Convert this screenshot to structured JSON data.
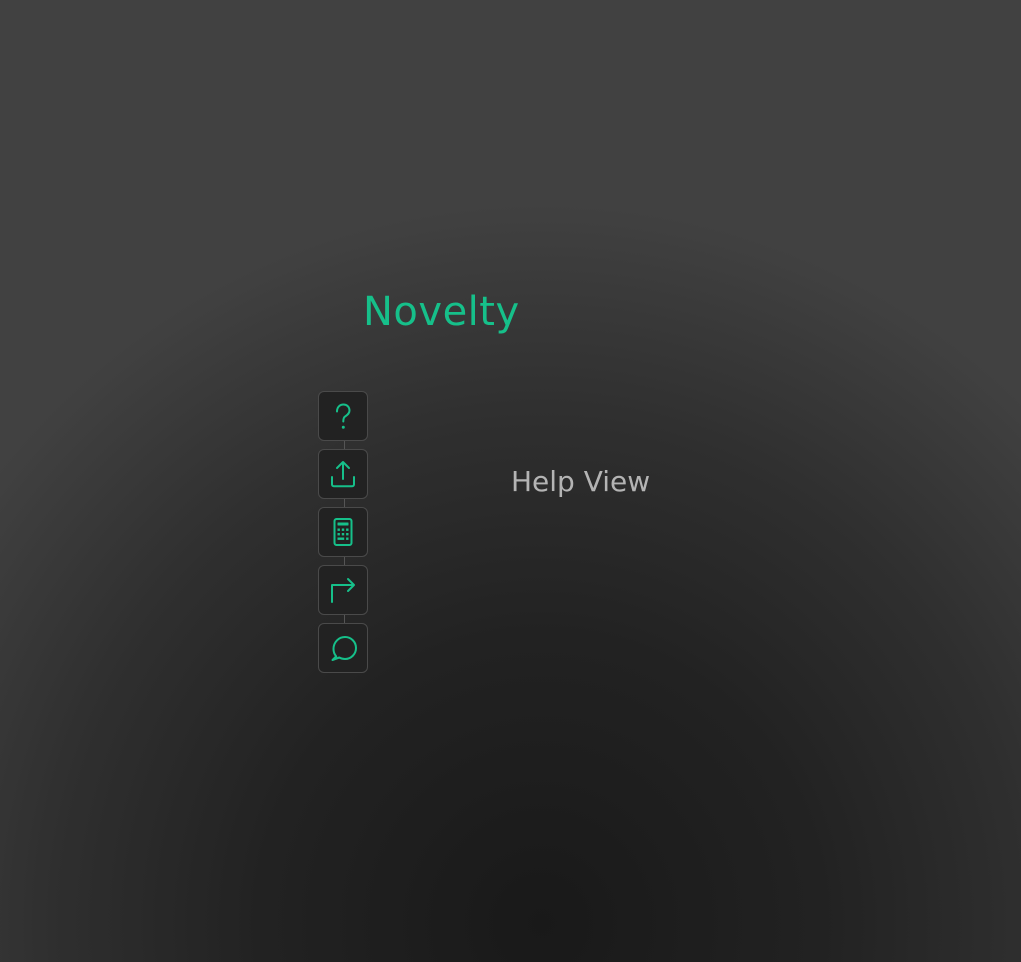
{
  "app": {
    "title": "Novelty"
  },
  "colors": {
    "accent": "#16c08a",
    "label": "#b4b4b4",
    "button_border": "#4a4a4a",
    "button_bg": "#222222"
  },
  "toolbar": {
    "buttons": [
      {
        "icon": "question-mark-icon",
        "action": "help"
      },
      {
        "icon": "upload-icon",
        "action": "upload"
      },
      {
        "icon": "calculator-icon",
        "action": "calculator"
      },
      {
        "icon": "redirect-arrow-icon",
        "action": "forward"
      },
      {
        "icon": "chat-bubble-icon",
        "action": "chat"
      }
    ]
  },
  "main": {
    "view_label": "Help View"
  }
}
